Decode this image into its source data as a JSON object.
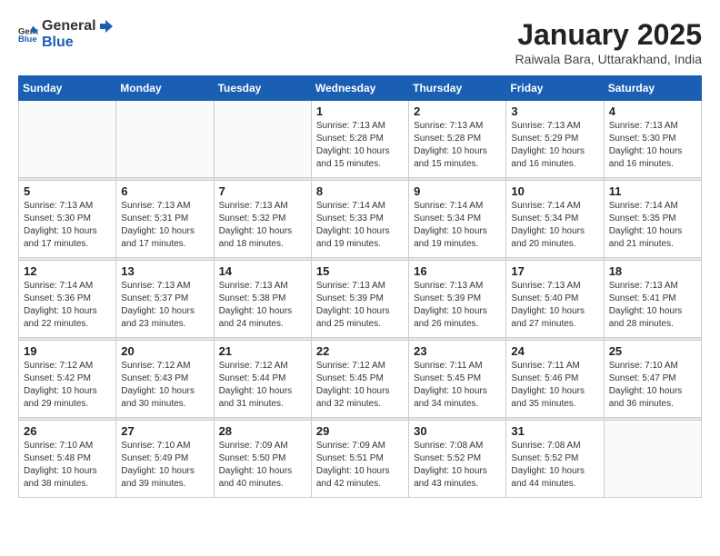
{
  "header": {
    "logo_general": "General",
    "logo_blue": "Blue",
    "title": "January 2025",
    "subtitle": "Raiwala Bara, Uttarakhand, India"
  },
  "days": [
    "Sunday",
    "Monday",
    "Tuesday",
    "Wednesday",
    "Thursday",
    "Friday",
    "Saturday"
  ],
  "weeks": [
    [
      {
        "date": "",
        "info": ""
      },
      {
        "date": "",
        "info": ""
      },
      {
        "date": "",
        "info": ""
      },
      {
        "date": "1",
        "info": "Sunrise: 7:13 AM\nSunset: 5:28 PM\nDaylight: 10 hours and 15 minutes."
      },
      {
        "date": "2",
        "info": "Sunrise: 7:13 AM\nSunset: 5:28 PM\nDaylight: 10 hours and 15 minutes."
      },
      {
        "date": "3",
        "info": "Sunrise: 7:13 AM\nSunset: 5:29 PM\nDaylight: 10 hours and 16 minutes."
      },
      {
        "date": "4",
        "info": "Sunrise: 7:13 AM\nSunset: 5:30 PM\nDaylight: 10 hours and 16 minutes."
      }
    ],
    [
      {
        "date": "5",
        "info": "Sunrise: 7:13 AM\nSunset: 5:30 PM\nDaylight: 10 hours and 17 minutes."
      },
      {
        "date": "6",
        "info": "Sunrise: 7:13 AM\nSunset: 5:31 PM\nDaylight: 10 hours and 17 minutes."
      },
      {
        "date": "7",
        "info": "Sunrise: 7:13 AM\nSunset: 5:32 PM\nDaylight: 10 hours and 18 minutes."
      },
      {
        "date": "8",
        "info": "Sunrise: 7:14 AM\nSunset: 5:33 PM\nDaylight: 10 hours and 19 minutes."
      },
      {
        "date": "9",
        "info": "Sunrise: 7:14 AM\nSunset: 5:34 PM\nDaylight: 10 hours and 19 minutes."
      },
      {
        "date": "10",
        "info": "Sunrise: 7:14 AM\nSunset: 5:34 PM\nDaylight: 10 hours and 20 minutes."
      },
      {
        "date": "11",
        "info": "Sunrise: 7:14 AM\nSunset: 5:35 PM\nDaylight: 10 hours and 21 minutes."
      }
    ],
    [
      {
        "date": "12",
        "info": "Sunrise: 7:14 AM\nSunset: 5:36 PM\nDaylight: 10 hours and 22 minutes."
      },
      {
        "date": "13",
        "info": "Sunrise: 7:13 AM\nSunset: 5:37 PM\nDaylight: 10 hours and 23 minutes."
      },
      {
        "date": "14",
        "info": "Sunrise: 7:13 AM\nSunset: 5:38 PM\nDaylight: 10 hours and 24 minutes."
      },
      {
        "date": "15",
        "info": "Sunrise: 7:13 AM\nSunset: 5:39 PM\nDaylight: 10 hours and 25 minutes."
      },
      {
        "date": "16",
        "info": "Sunrise: 7:13 AM\nSunset: 5:39 PM\nDaylight: 10 hours and 26 minutes."
      },
      {
        "date": "17",
        "info": "Sunrise: 7:13 AM\nSunset: 5:40 PM\nDaylight: 10 hours and 27 minutes."
      },
      {
        "date": "18",
        "info": "Sunrise: 7:13 AM\nSunset: 5:41 PM\nDaylight: 10 hours and 28 minutes."
      }
    ],
    [
      {
        "date": "19",
        "info": "Sunrise: 7:12 AM\nSunset: 5:42 PM\nDaylight: 10 hours and 29 minutes."
      },
      {
        "date": "20",
        "info": "Sunrise: 7:12 AM\nSunset: 5:43 PM\nDaylight: 10 hours and 30 minutes."
      },
      {
        "date": "21",
        "info": "Sunrise: 7:12 AM\nSunset: 5:44 PM\nDaylight: 10 hours and 31 minutes."
      },
      {
        "date": "22",
        "info": "Sunrise: 7:12 AM\nSunset: 5:45 PM\nDaylight: 10 hours and 32 minutes."
      },
      {
        "date": "23",
        "info": "Sunrise: 7:11 AM\nSunset: 5:45 PM\nDaylight: 10 hours and 34 minutes."
      },
      {
        "date": "24",
        "info": "Sunrise: 7:11 AM\nSunset: 5:46 PM\nDaylight: 10 hours and 35 minutes."
      },
      {
        "date": "25",
        "info": "Sunrise: 7:10 AM\nSunset: 5:47 PM\nDaylight: 10 hours and 36 minutes."
      }
    ],
    [
      {
        "date": "26",
        "info": "Sunrise: 7:10 AM\nSunset: 5:48 PM\nDaylight: 10 hours and 38 minutes."
      },
      {
        "date": "27",
        "info": "Sunrise: 7:10 AM\nSunset: 5:49 PM\nDaylight: 10 hours and 39 minutes."
      },
      {
        "date": "28",
        "info": "Sunrise: 7:09 AM\nSunset: 5:50 PM\nDaylight: 10 hours and 40 minutes."
      },
      {
        "date": "29",
        "info": "Sunrise: 7:09 AM\nSunset: 5:51 PM\nDaylight: 10 hours and 42 minutes."
      },
      {
        "date": "30",
        "info": "Sunrise: 7:08 AM\nSunset: 5:52 PM\nDaylight: 10 hours and 43 minutes."
      },
      {
        "date": "31",
        "info": "Sunrise: 7:08 AM\nSunset: 5:52 PM\nDaylight: 10 hours and 44 minutes."
      },
      {
        "date": "",
        "info": ""
      }
    ]
  ]
}
